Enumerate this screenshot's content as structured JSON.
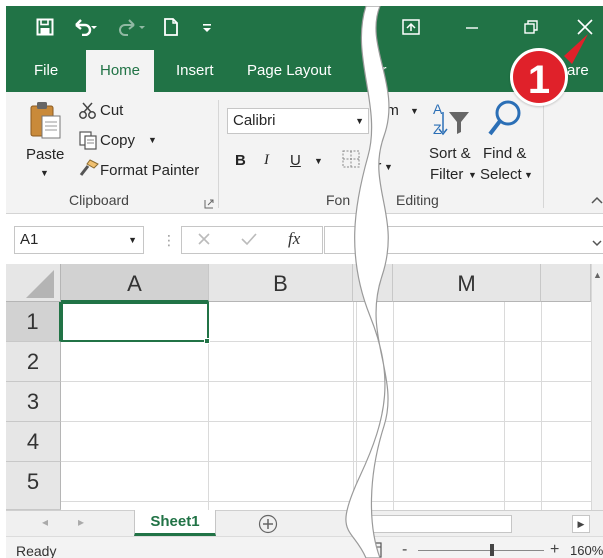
{
  "title_bar": {
    "bg_color": "#217346",
    "quick_access_icons": [
      "save-icon",
      "undo-icon",
      "redo-icon",
      "new-document-icon",
      "customize-icon"
    ],
    "window_buttons": [
      "ribbon-display-options-icon",
      "minimize-icon",
      "restore-icon",
      "close-icon"
    ]
  },
  "tabs": [
    {
      "label": "File",
      "active": false
    },
    {
      "label": "Home",
      "active": true
    },
    {
      "label": "Insert",
      "active": false
    },
    {
      "label": "Page Layout",
      "active": false
    },
    {
      "label": "For",
      "active": false
    },
    {
      "label": "are",
      "active": false
    }
  ],
  "ribbon": {
    "clipboard": {
      "paste_label": "Paste",
      "cut_label": "Cut",
      "copy_label": "Copy",
      "format_painter_label": "Format Painter",
      "group_label": "Clipboard"
    },
    "font": {
      "font_name": "Calibri",
      "bold_label": "B",
      "italic_label": "I",
      "underline_label": "U",
      "group_label_partial": "Fon"
    },
    "partial_labels": {
      "number_top": "um",
      "number_bottom": "ar"
    },
    "editing": {
      "sort_filter_line1": "Sort &",
      "sort_filter_line2": "Filter",
      "find_select_line1": "Find &",
      "find_select_line2": "Select",
      "group_label": "Editing"
    }
  },
  "formula_bar": {
    "name_box": "A1",
    "fx_label": "fx",
    "formula_value": ""
  },
  "grid": {
    "columns": [
      "A",
      "B",
      "M"
    ],
    "rows": [
      "1",
      "2",
      "3",
      "4",
      "5"
    ],
    "selected_cell": "A1"
  },
  "sheet_tabs": [
    {
      "label": "Sheet1",
      "active": true
    }
  ],
  "status_bar": {
    "status_text": "Ready",
    "zoom_level": "160%",
    "zoom_out_label": "-",
    "zoom_in_label": "+"
  },
  "callout": {
    "number": "1",
    "color": "#e0212a"
  },
  "accent_color": "#217346"
}
